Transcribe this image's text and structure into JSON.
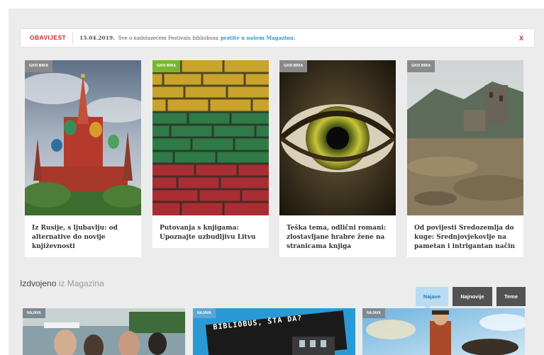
{
  "notice": {
    "label": "OBAVIJEST",
    "date": "15.04.2019.",
    "text": "Sve o nadolazećem Festivalu bibliobusa",
    "link": "pratite u našem Magazinu.",
    "close": "X"
  },
  "cards": [
    {
      "badge": "GKR BIRA",
      "title": "Iz Rusije, s ljubavlju: od alternative do novije književnosti",
      "image": "st-basils-cathedral"
    },
    {
      "badge": "GKR BIRA",
      "title": "Putovanja s knjigama: Upoznajte uzbudljivu Litvu",
      "image": "lithuanian-flag-brick-wall"
    },
    {
      "badge": "GKR BIRA",
      "title": "Teška tema, odlični romani: zlostavljane hrabre žene na stranicama knjiga",
      "image": "eye-closeup"
    },
    {
      "badge": "GKR BIRA",
      "title": "Od povijesti Sredozemlja do kuge: Srednjovjekovlje na pametan i intrigantan način",
      "image": "castle-ruins"
    }
  ],
  "section": {
    "title_main": "Izdvojeno",
    "title_muted": " iz Magazina"
  },
  "tabs": [
    "Najave",
    "Najnovije",
    "Teme"
  ],
  "magazine_cards": [
    {
      "badge": "NAJAVA",
      "image": "festival-crowd"
    },
    {
      "badge": "NAJAVA",
      "image": "bibliobus-poster",
      "caption": "BIBLIOBUS, ŠTA DA?"
    },
    {
      "badge": "NAJAVA",
      "image": "illustrated-character"
    }
  ],
  "colors": {
    "accent_red": "#c9292e",
    "link_blue": "#2a9ad0",
    "badge_green": "#79b82c",
    "badge_grey": "#8a8a8a"
  }
}
